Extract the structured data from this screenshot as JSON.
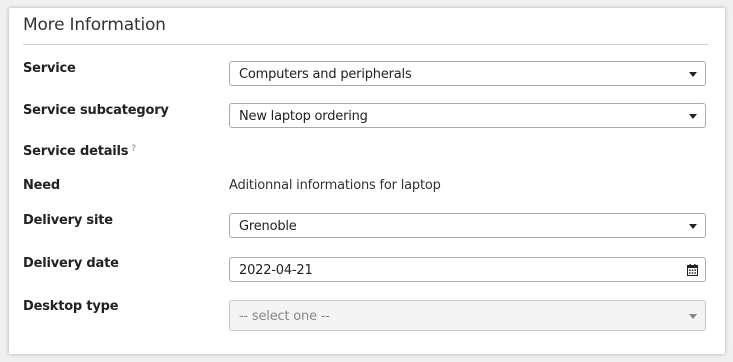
{
  "section": {
    "title": "More Information"
  },
  "fields": {
    "service": {
      "label": "Service",
      "value": "Computers and peripherals"
    },
    "subcategory": {
      "label": "Service subcategory",
      "value": "New laptop ordering"
    },
    "details": {
      "label": "Service details",
      "help": "?"
    },
    "need": {
      "label": "Need",
      "value": "Aditionnal informations for laptop"
    },
    "delivery_site": {
      "label": "Delivery site",
      "value": "Grenoble"
    },
    "delivery_date": {
      "label": "Delivery date",
      "value": "2022-04-21"
    },
    "desktop_type": {
      "label": "Desktop type",
      "placeholder": "-- select one --"
    }
  }
}
